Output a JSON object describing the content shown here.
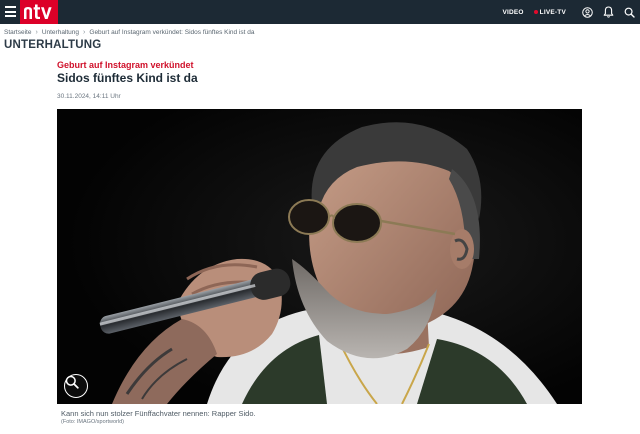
{
  "nav": {
    "logo_text": "ntv",
    "brand_color": "#dc0028",
    "bar_color": "#1c2934",
    "video_label": "VIDEO",
    "live_label": "LIVE-TV",
    "icons": [
      "menu-icon",
      "user-icon",
      "bell-icon",
      "search-icon"
    ]
  },
  "breadcrumb": {
    "items": [
      "Startseite",
      "Unterhaltung",
      "Geburt auf Instagram verkündet: Sidos fünftes Kind ist da"
    ]
  },
  "section": {
    "title": "UNTERHALTUNG"
  },
  "article": {
    "kicker": "Geburt auf Instagram verkündet",
    "headline": "Sidos fünftes Kind ist da",
    "date": "30.11.2024, 14:11 Uhr",
    "image": {
      "caption": "Kann sich nun stolzer Fünffachvater nennen: Rapper Sido.",
      "credit": "(Foto: IMAGO/sportworld)",
      "zoom_icon": "zoom-in-icon"
    }
  }
}
